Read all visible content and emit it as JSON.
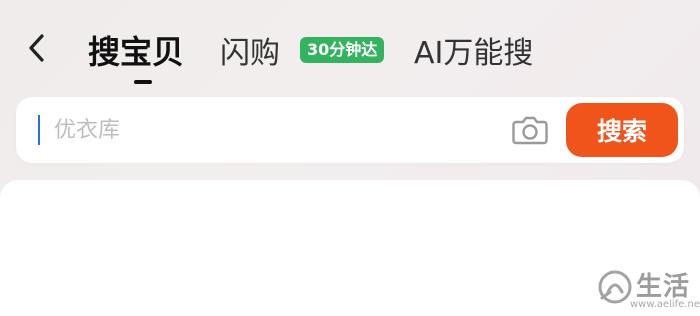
{
  "nav": {
    "back_icon": "chevron-left-icon",
    "tabs": [
      {
        "label": "搜宝贝",
        "active": true
      },
      {
        "label": "闪购",
        "active": false
      },
      {
        "label": "AI万能搜",
        "active": false
      }
    ],
    "badge": "30分钟达",
    "badge_color": "#33b35f"
  },
  "search": {
    "placeholder": "优衣库",
    "value": "",
    "camera_icon": "camera-icon",
    "button_label": "搜索",
    "button_color": "#f0541b"
  },
  "watermark": {
    "text": "生活",
    "url": "www.aelife.net"
  }
}
